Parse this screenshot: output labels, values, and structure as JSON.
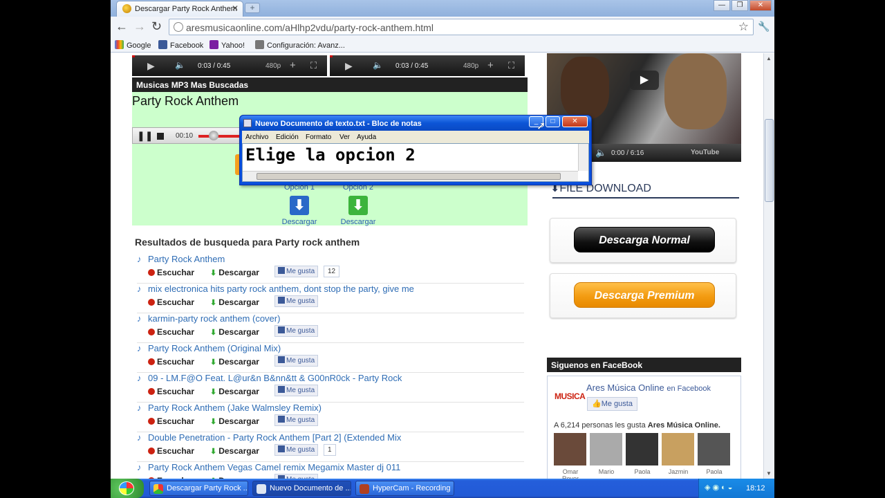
{
  "browser": {
    "tab_title": "Descargar Party Rock Anthem",
    "url": "aresmusicaonline.com/aHlhp2vdu/party-rock-anthem.html",
    "bookmarks": [
      "Google",
      "Facebook",
      "Yahoo!",
      "Configuración: Avanz..."
    ]
  },
  "players": [
    {
      "time": "0:03 / 0:45",
      "quality": "480p"
    },
    {
      "time": "0:03 / 0:45",
      "quality": "480p"
    }
  ],
  "left": {
    "section_header": "Musicas MP3 Mas Buscadas",
    "song_title": "Party Rock Anthem",
    "audio_time": "00:10",
    "option1_label": "Opcion 1",
    "option2_label": "Opcion 2",
    "download_label": "Descargar",
    "results_title": "Resultados de busqueda para Party rock anthem"
  },
  "results": {
    "listen_label": "Escuchar",
    "download_label": "Descargar",
    "like_label": "Me gusta",
    "items": [
      {
        "title": "Party Rock Anthem",
        "count": "12"
      },
      {
        "title": "mix electronica hits party rock anthem, dont stop the party, give me",
        "count": ""
      },
      {
        "title": "karmin-party rock anthem (cover)",
        "count": ""
      },
      {
        "title": "Party Rock Anthem (Original Mix)",
        "count": ""
      },
      {
        "title": "09 - LM.F@O Feat. L@ur&n B&nn&tt & G00nR0ck - Party Rock",
        "count": ""
      },
      {
        "title": "Party Rock Anthem (Jake Walmsley Remix)",
        "count": ""
      },
      {
        "title": "Double Penetration - Party Rock Anthem [Part 2] (Extended Mix",
        "count": "1"
      },
      {
        "title": "Party Rock Anthem Vegas Camel remix Megamix Master dj 011",
        "count": ""
      }
    ]
  },
  "right": {
    "video_time": "0:00 / 6:16",
    "youtube_label": "YouTube",
    "file_download": "FILE DOWNLOAD",
    "btn_normal": "Descarga Normal",
    "btn_premium": "Descarga Premium",
    "fb_header": "Siguenos en FaceBook",
    "fb_page_name": "Ares Música Online",
    "fb_en": "en Facebook",
    "fb_like": "Me gusta",
    "fb_people_prefix": "A 6,214 personas les gusta",
    "fb_people_page": "Ares Música Online.",
    "logo_text": "MUSICA",
    "fans": [
      "Omar Royer",
      "Mario",
      "Paola",
      "Jazmin",
      "Paola"
    ]
  },
  "notepad": {
    "title": "Nuevo Documento de texto.txt - Bloc de notas",
    "menu": [
      "Archivo",
      "Edición",
      "Formato",
      "Ver",
      "Ayuda"
    ],
    "content": "Elige la opcion 2"
  },
  "taskbar": {
    "tasks": [
      "Descargar Party Rock ...",
      "Nuevo Documento de ...",
      "HyperCam - Recording"
    ],
    "clock": "18:12"
  },
  "colors": {
    "green_panel": "#ccffcc",
    "link_blue": "#2f6db5",
    "premium_orange": "#f39c12",
    "xp_blue": "#245edb"
  }
}
